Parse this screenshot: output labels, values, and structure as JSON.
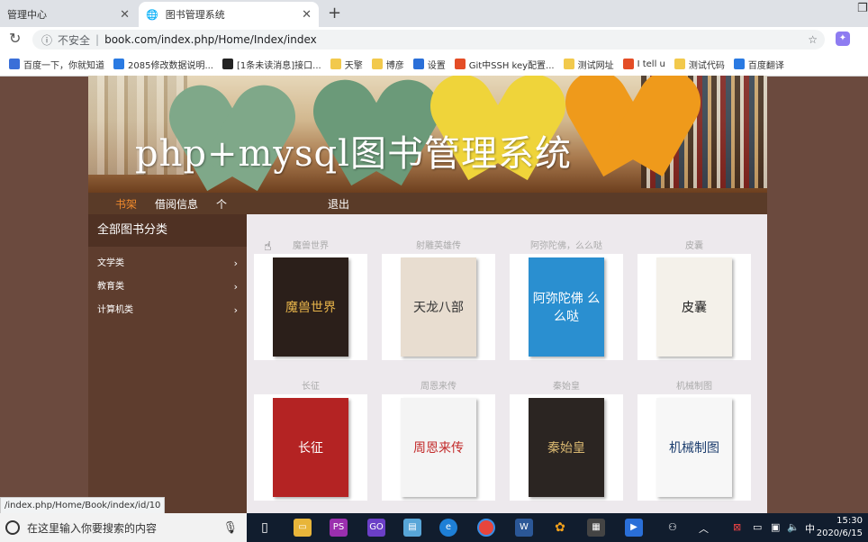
{
  "browser": {
    "tabs": [
      {
        "title": "管理中心"
      },
      {
        "title": "图书管理系统"
      }
    ],
    "new_tab": "+",
    "address": {
      "insecure_label": "不安全",
      "url": "book.com/index.php/Home/Index/index"
    },
    "bookmarks": [
      {
        "label": "百度一下，你就知道",
        "color": "#3a6fd8"
      },
      {
        "label": "2085修改数据说明...",
        "color": "#2a7ae2"
      },
      {
        "label": "[1条未读消息]接口...",
        "color": "#222222"
      },
      {
        "label": "天擎",
        "color": "#f2c94c"
      },
      {
        "label": "博彦",
        "color": "#f2c94c"
      },
      {
        "label": "设置",
        "color": "#2a6fd8"
      },
      {
        "label": "Git中SSH key配置...",
        "color": "#e44d26"
      },
      {
        "label": "测试网址",
        "color": "#f2c94c"
      },
      {
        "label": "I tell u",
        "color": "#e44d26"
      },
      {
        "label": "测试代码",
        "color": "#f2c94c"
      },
      {
        "label": "百度翻译",
        "color": "#2a7ae2"
      }
    ]
  },
  "site": {
    "overlay_title": "php+mysql图书管理系统",
    "nav": [
      "书架",
      "借阅信息",
      "个",
      "退出"
    ],
    "sidebar": {
      "heading": "全部图书分类",
      "categories": [
        "文学类",
        "教育类",
        "计算机类"
      ]
    },
    "books": [
      {
        "name": "魔兽世界",
        "cover_text": "魔兽世界",
        "cover_color": "#2b1f1a",
        "text_color": "#e6b34a"
      },
      {
        "name": "射雕英雄传",
        "cover_text": "天龙八部",
        "cover_color": "#e8ddd0",
        "text_color": "#333333"
      },
      {
        "name": "阿弥陀佛，么么哒",
        "cover_text": "阿弥陀佛 么么哒",
        "cover_color": "#2a8fd0",
        "text_color": "#ffffff"
      },
      {
        "name": "皮囊",
        "cover_text": "皮囊",
        "cover_color": "#f4f1ea",
        "text_color": "#222222"
      },
      {
        "name": "长征",
        "cover_text": "长征",
        "cover_color": "#b42323",
        "text_color": "#ffffff"
      },
      {
        "name": "周恩来传",
        "cover_text": "周恩来传",
        "cover_color": "#f4f4f4",
        "text_color": "#c22a2a"
      },
      {
        "name": "秦始皇",
        "cover_text": "秦始皇",
        "cover_color": "#2b2522",
        "text_color": "#d9b871"
      },
      {
        "name": "机械制图",
        "cover_text": "机械制图",
        "cover_color": "#f7f7f7",
        "text_color": "#1c3d6e"
      }
    ]
  },
  "status_url": "/index.php/Home/Book/index/id/10",
  "taskbar": {
    "search_placeholder": "在这里输入你要搜索的内容",
    "ime": "中",
    "time": "15:30",
    "date": "2020/6/15"
  }
}
